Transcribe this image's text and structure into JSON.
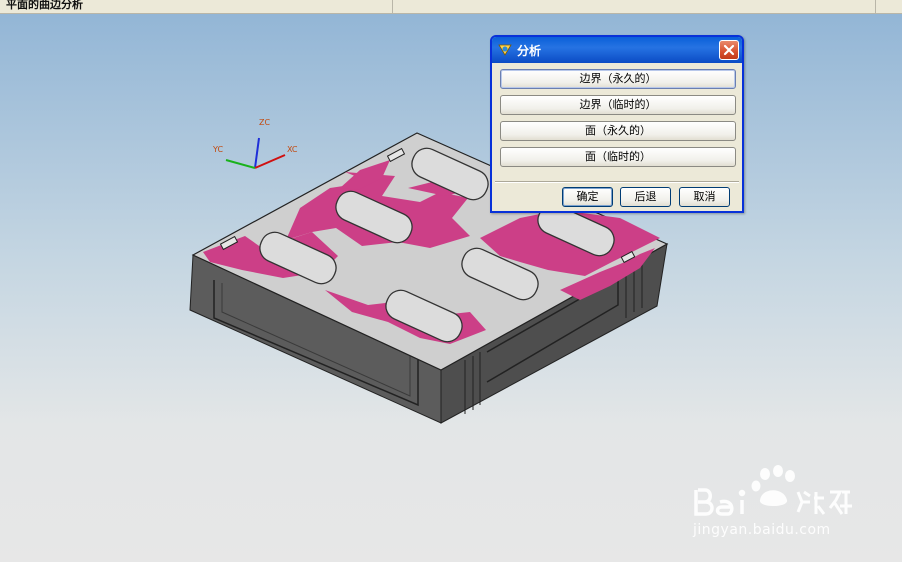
{
  "window": {
    "title": "平面的曲边分析"
  },
  "triad": {
    "zc": "ZC",
    "yc": "YC",
    "xc": "XC"
  },
  "dialog": {
    "title": "分析",
    "options": [
      {
        "label": "边界（永久的）"
      },
      {
        "label": "边界（临时的）"
      },
      {
        "label": "面（永久的）"
      },
      {
        "label": "面（临时的）"
      }
    ],
    "buttons": {
      "ok": "确定",
      "back": "后退",
      "cancel": "取消"
    }
  },
  "watermark": {
    "logo_text": "Baidu经验",
    "url": "jingyan.baidu.com"
  },
  "colors": {
    "part_top": "#cfcfcf",
    "part_highlight": "#cc3f87",
    "part_side": "#5c5c5c",
    "dialog_title": "#0a5fd8"
  }
}
